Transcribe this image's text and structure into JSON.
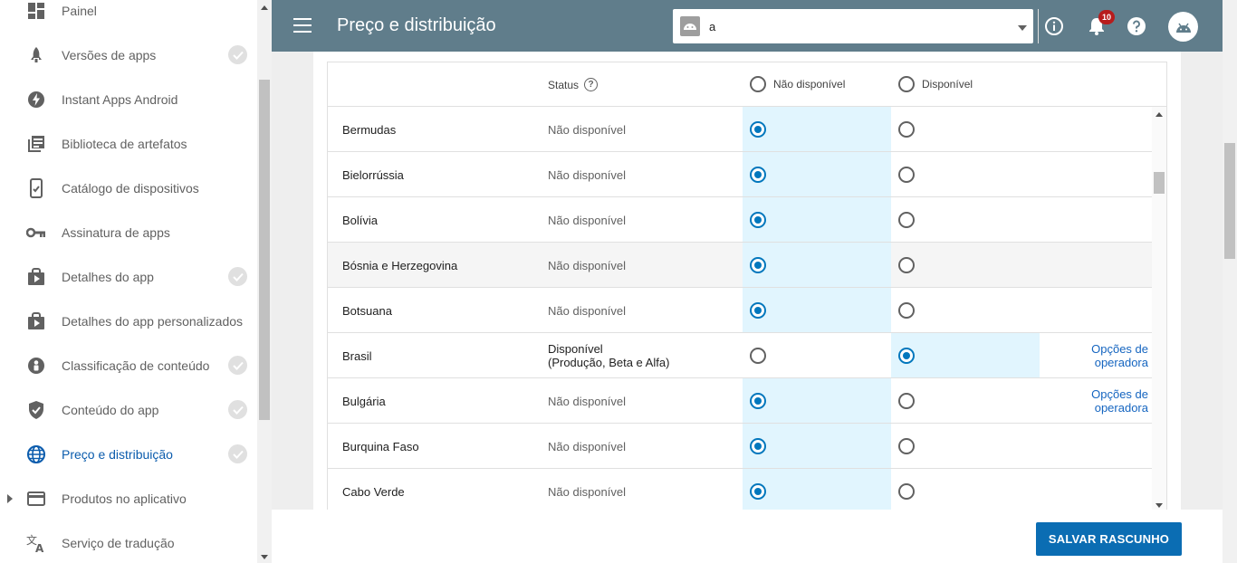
{
  "sidebar": {
    "items": [
      {
        "label": "Painel",
        "icon": "dashboard-icon",
        "check": false
      },
      {
        "label": "Versões de apps",
        "icon": "rocket-icon",
        "check": true
      },
      {
        "label": "Instant Apps Android",
        "icon": "bolt-icon",
        "check": false
      },
      {
        "label": "Biblioteca de artefatos",
        "icon": "library-icon",
        "check": false
      },
      {
        "label": "Catálogo de dispositivos",
        "icon": "device-icon",
        "check": false
      },
      {
        "label": "Assinatura de apps",
        "icon": "key-icon",
        "check": false
      },
      {
        "label": "Detalhes do app",
        "icon": "store-icon",
        "check": true
      },
      {
        "label": "Detalhes do app personalizados",
        "icon": "store-icon",
        "check": false
      },
      {
        "label": "Classificação de conteúdo",
        "icon": "rating-icon",
        "check": true
      },
      {
        "label": "Conteúdo do app",
        "icon": "shield-icon",
        "check": true
      },
      {
        "label": "Preço e distribuição",
        "icon": "globe-icon",
        "check": true,
        "active": true
      },
      {
        "label": "Produtos no aplicativo",
        "icon": "card-icon",
        "check": false,
        "expandable": true
      },
      {
        "label": "Serviço de tradução",
        "icon": "translate-icon",
        "check": false
      }
    ]
  },
  "header": {
    "title": "Preço e distribuição",
    "app_name": "a",
    "notification_count": "10"
  },
  "table": {
    "headers": {
      "status": "Status",
      "not_available": "Não disponível",
      "available": "Disponível"
    },
    "rows": [
      {
        "country": "Bermudas",
        "status": "Não disponível",
        "status_detail": "",
        "available": false,
        "options": ""
      },
      {
        "country": "Bielorrússia",
        "status": "Não disponível",
        "status_detail": "",
        "available": false,
        "options": ""
      },
      {
        "country": "Bolívia",
        "status": "Não disponível",
        "status_detail": "",
        "available": false,
        "options": ""
      },
      {
        "country": "Bósnia e Herzegovina",
        "status": "Não disponível",
        "status_detail": "",
        "available": false,
        "options": "",
        "hover": true
      },
      {
        "country": "Botsuana",
        "status": "Não disponível",
        "status_detail": "",
        "available": false,
        "options": ""
      },
      {
        "country": "Brasil",
        "status": "Disponível",
        "status_detail": "(Produção, Beta e Alfa)",
        "available": true,
        "options": "Opções de operadora"
      },
      {
        "country": "Bulgária",
        "status": "Não disponível",
        "status_detail": "",
        "available": false,
        "options": "Opções de operadora"
      },
      {
        "country": "Burquina Faso",
        "status": "Não disponível",
        "status_detail": "",
        "available": false,
        "options": ""
      },
      {
        "country": "Cabo Verde",
        "status": "Não disponível",
        "status_detail": "",
        "available": false,
        "options": ""
      }
    ]
  },
  "footer": {
    "save_label": "SALVAR RASCUNHO"
  },
  "colors": {
    "header_bg": "#607d8b",
    "accent": "#0277bd",
    "selected_cell": "#e1f5fe",
    "save_button": "#0b6db3"
  }
}
